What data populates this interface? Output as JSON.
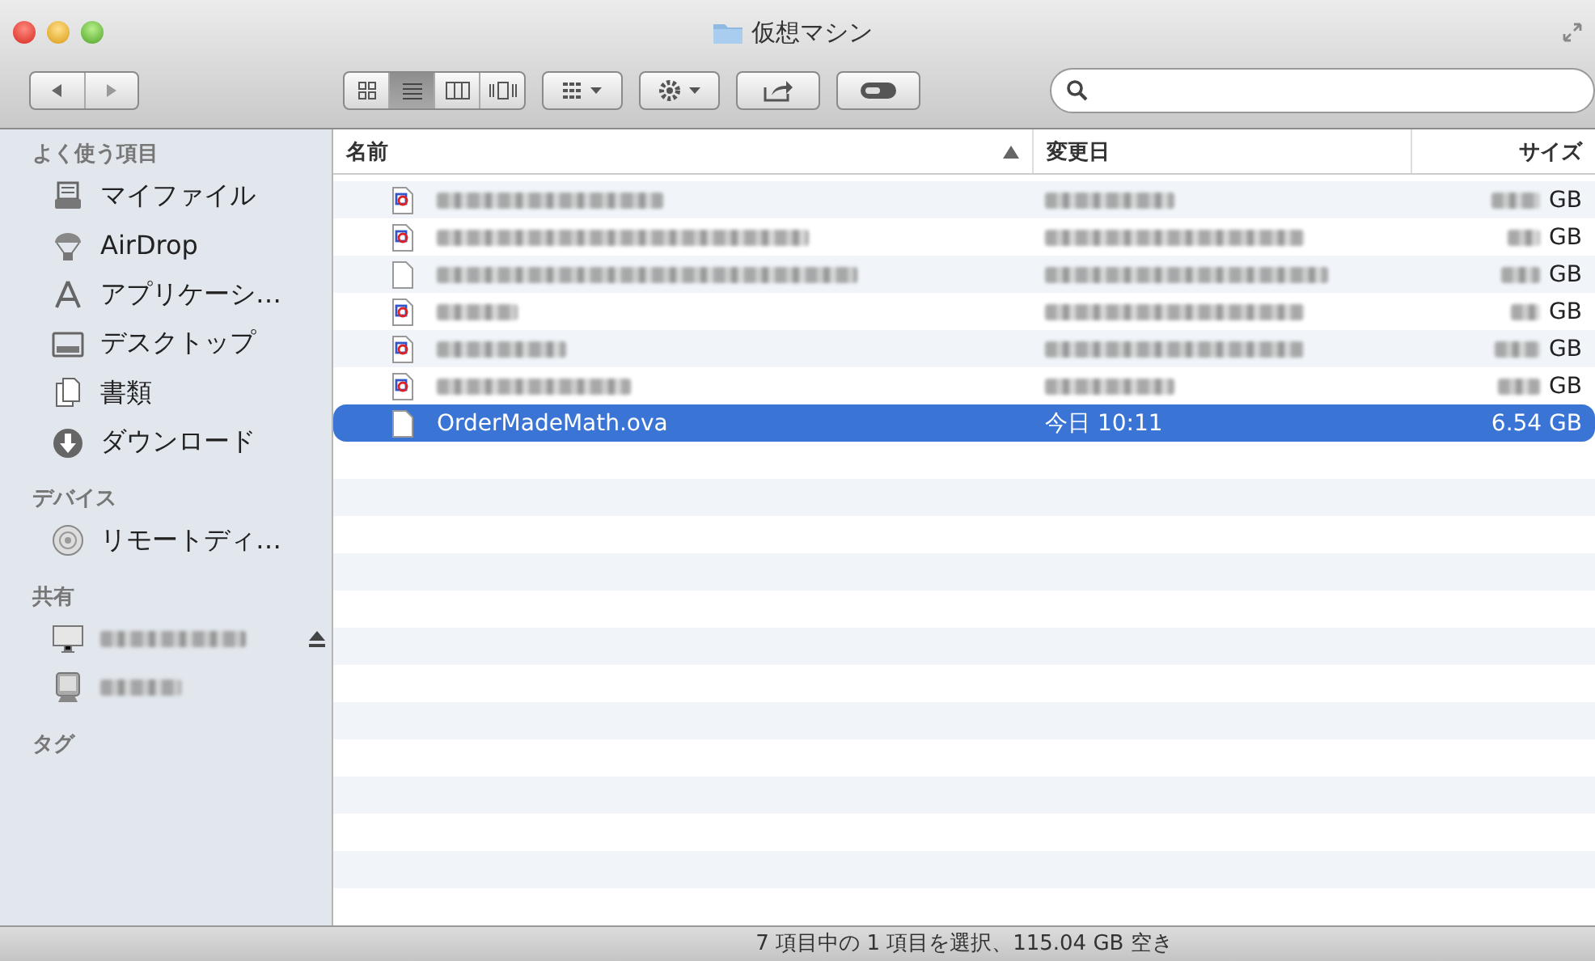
{
  "window": {
    "title": "仮想マシン"
  },
  "toolbar": {
    "view_modes": [
      {
        "kind": "icons",
        "selected": false
      },
      {
        "kind": "list",
        "selected": true
      },
      {
        "kind": "columns",
        "selected": false
      },
      {
        "kind": "coverflow",
        "selected": false
      }
    ]
  },
  "sidebar": {
    "sections": [
      {
        "title": "よく使う項目",
        "items": [
          {
            "label": "マイファイル"
          },
          {
            "label": "AirDrop"
          },
          {
            "label": "アプリケーシ…"
          },
          {
            "label": "デスクトップ"
          },
          {
            "label": "書類"
          },
          {
            "label": "ダウンロード"
          }
        ]
      },
      {
        "title": "デバイス",
        "items": [
          {
            "label": "リモートディ…"
          }
        ]
      },
      {
        "title": "共有",
        "items": [
          {
            "eject": true
          },
          {
            "eject": false
          }
        ]
      },
      {
        "title": "タグ"
      }
    ]
  },
  "table": {
    "columns": [
      {
        "label": "名前",
        "sorted": true
      },
      {
        "label": "変更日",
        "sorted": false
      },
      {
        "label": "サイズ",
        "sorted": false
      }
    ],
    "rows": [
      {
        "kind": "vm",
        "size_unit": "GB",
        "selected": false
      },
      {
        "kind": "vm",
        "size_unit": "GB",
        "selected": false
      },
      {
        "kind": "document",
        "size_unit": "GB",
        "selected": false
      },
      {
        "kind": "vm",
        "size_unit": "GB",
        "selected": false
      },
      {
        "kind": "vm",
        "size_unit": "GB",
        "selected": false
      },
      {
        "kind": "vm",
        "size_unit": "GB",
        "selected": false
      },
      {
        "kind": "document",
        "name": "OrderMadeMath.ova",
        "date": "今日 10:11",
        "size": "6.54 GB",
        "selected": true
      }
    ]
  },
  "status_bar": "7 項目中の 1 項目を選択、115.04 GB 空き"
}
